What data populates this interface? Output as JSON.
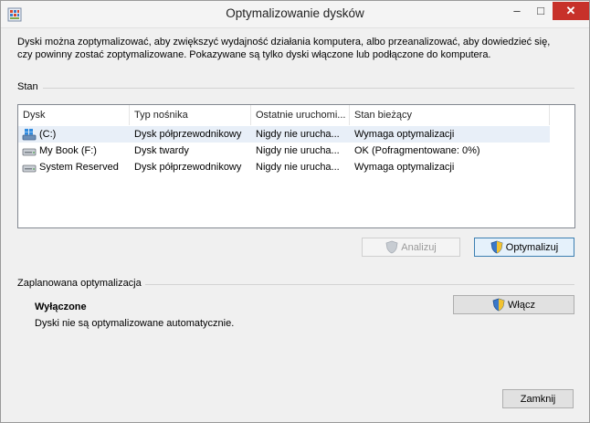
{
  "window": {
    "title": "Optymalizowanie dysków",
    "controls": {
      "minimize": "‒",
      "maximize": "□",
      "close": "✕"
    }
  },
  "description_line1": "Dyski można zoptymalizować, aby zwiększyć wydajność działania komputera, albo przeanalizować, aby dowiedzieć się,",
  "description_line2": "czy powinny zostać zoptymalizowane. Pokazywane są tylko dyski włączone lub podłączone do komputera.",
  "status_section": {
    "label": "Stan",
    "columns": [
      "Dysk",
      "Typ nośnika",
      "Ostatnie uruchomi...",
      "Stan bieżący"
    ],
    "rows": [
      {
        "drive": "(C:)",
        "icon": "system-drive-icon",
        "media": "Dysk półprzewodnikowy",
        "last_run": "Nigdy nie urucha...",
        "status": "Wymaga optymalizacji"
      },
      {
        "drive": "My Book (F:)",
        "icon": "hard-drive-icon",
        "media": "Dysk twardy",
        "last_run": "Nigdy nie urucha...",
        "status": "OK (Pofragmentowane: 0%)"
      },
      {
        "drive": "System Reserved",
        "icon": "hard-drive-icon",
        "media": "Dysk półprzewodnikowy",
        "last_run": "Nigdy nie urucha...",
        "status": "Wymaga optymalizacji"
      }
    ]
  },
  "buttons": {
    "analyze": "Analizuj",
    "optimize": "Optymalizuj",
    "enable": "Włącz",
    "close": "Zamknij"
  },
  "scheduled": {
    "label": "Zaplanowana optymalizacja",
    "status_title": "Wyłączone",
    "status_text": "Dyski nie są optymalizowane automatycznie."
  },
  "colors": {
    "close_button": "#c7312a",
    "selected_row": "#e8eff8",
    "primary_button_border": "#3c7fb1"
  }
}
